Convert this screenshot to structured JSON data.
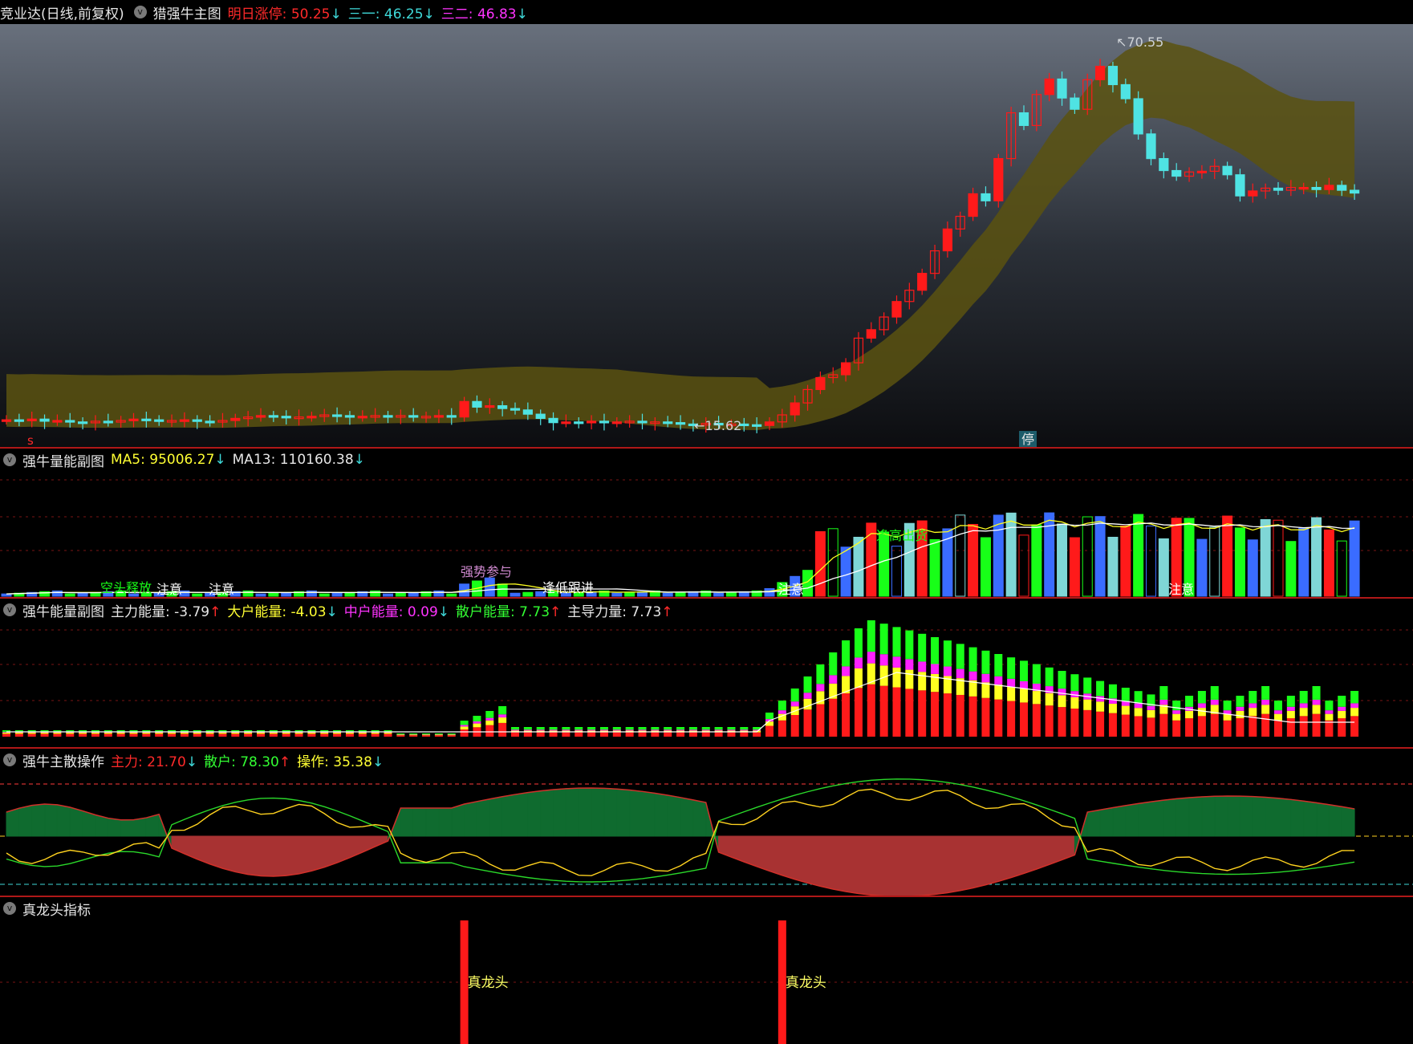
{
  "main": {
    "title": "竞业达(日线,前复权)",
    "indicator": "猎强牛主图",
    "items": [
      {
        "label": "明日涨停",
        "value": "50.25",
        "arrow": "↓"
      },
      {
        "label": "三一",
        "value": "46.25",
        "arrow": "↓"
      },
      {
        "label": "三二",
        "value": "46.83",
        "arrow": "↓"
      }
    ],
    "high_label": "70.55",
    "low_label": "15.62",
    "stop_badge": "停",
    "s_marker": "s"
  },
  "volume": {
    "title": "强牛量能副图",
    "ma5_label": "MA5",
    "ma5_value": "95006.27",
    "ma5_arrow": "↓",
    "ma13_label": "MA13",
    "ma13_value": "110160.38",
    "ma13_arrow": "↓",
    "annotations": [
      "空头释放",
      "注意",
      "注意",
      "强势参与",
      "逢低跟进",
      "注意",
      "逢高出货",
      "注意"
    ]
  },
  "energy": {
    "title": "强牛能量副图",
    "items": [
      {
        "label": "主力能量",
        "value": "-3.79",
        "arrow": "↑"
      },
      {
        "label": "大户能量",
        "value": "-4.03",
        "arrow": "↓"
      },
      {
        "label": "中户能量",
        "value": "0.09",
        "arrow": "↓"
      },
      {
        "label": "散户能量",
        "value": "7.73",
        "arrow": "↑"
      },
      {
        "label": "主导力量",
        "value": "7.73",
        "arrow": "↑"
      }
    ]
  },
  "ops": {
    "title": "强牛主散操作",
    "items": [
      {
        "label": "主力",
        "value": "21.70",
        "arrow": "↓"
      },
      {
        "label": "散户",
        "value": "78.30",
        "arrow": "↑"
      },
      {
        "label": "操作",
        "value": "35.38",
        "arrow": "↓"
      }
    ]
  },
  "dragon": {
    "title": "真龙头指标",
    "signal_label": "真龙头"
  },
  "colors": {
    "up": "#ff1a1a",
    "down": "#4fe3e3",
    "band": "#5a5210",
    "divider": "#b01818",
    "green": "#18ff18",
    "blue": "#3a6cff",
    "yellow": "#ffff20",
    "magenta": "#ff20ff"
  },
  "chart_data": [
    {
      "type": "candlestick",
      "title": "竞业达(日线,前复权)",
      "range": [
        15.62,
        70.55
      ],
      "annotations": [
        "70.55",
        "15.62"
      ],
      "close": [
        16.4,
        16.3,
        16.5,
        16.2,
        16.3,
        16.1,
        16.0,
        16.2,
        16.1,
        16.3,
        16.5,
        16.4,
        16.2,
        16.3,
        16.4,
        16.2,
        16.1,
        16.3,
        16.6,
        16.8,
        17.0,
        16.9,
        16.7,
        16.8,
        16.9,
        17.1,
        17.0,
        16.8,
        16.9,
        17.0,
        16.9,
        17.0,
        16.8,
        16.9,
        17.0,
        16.8,
        19.0,
        18.2,
        18.4,
        18.0,
        17.8,
        17.2,
        16.6,
        16.0,
        16.1,
        16.0,
        16.2,
        16.0,
        16.1,
        16.2,
        16.0,
        16.1,
        16.0,
        15.8,
        15.7,
        15.9,
        15.8,
        15.8,
        15.7,
        15.6,
        16.1,
        17.1,
        18.8,
        20.7,
        22.4,
        22.8,
        24.5,
        28.0,
        29.2,
        31.0,
        33.2,
        34.8,
        37.2,
        40.4,
        43.5,
        45.3,
        48.5,
        47.5,
        53.5,
        60.0,
        58.2,
        62.6,
        64.8,
        62.1,
        60.5,
        64.7,
        66.6,
        64.0,
        62.0,
        57.0,
        53.5,
        51.8,
        51.0,
        51.6,
        51.7,
        52.4,
        51.2,
        48.2,
        48.9,
        49.3,
        49.0,
        49.4,
        49.4,
        49.1,
        49.7,
        49.0,
        48.6
      ]
    },
    {
      "type": "bar",
      "title": "强牛量能副图",
      "series": [
        {
          "name": "MA5",
          "last": 95006.27
        },
        {
          "name": "MA13",
          "last": 110160.38
        }
      ]
    },
    {
      "type": "bar",
      "title": "强牛能量副图",
      "series": [
        {
          "name": "主力能量",
          "last": -3.79
        },
        {
          "name": "大户能量",
          "last": -4.03
        },
        {
          "name": "中户能量",
          "last": 0.09
        },
        {
          "name": "散户能量",
          "last": 7.73
        },
        {
          "name": "主导力量",
          "last": 7.73
        }
      ]
    },
    {
      "type": "area",
      "title": "强牛主散操作",
      "series": [
        {
          "name": "主力",
          "last": 21.7
        },
        {
          "name": "散户",
          "last": 78.3
        },
        {
          "name": "操作",
          "last": 35.38
        }
      ]
    },
    {
      "type": "bar",
      "title": "真龙头指标",
      "annotations": [
        "真龙头",
        "真龙头"
      ]
    }
  ]
}
